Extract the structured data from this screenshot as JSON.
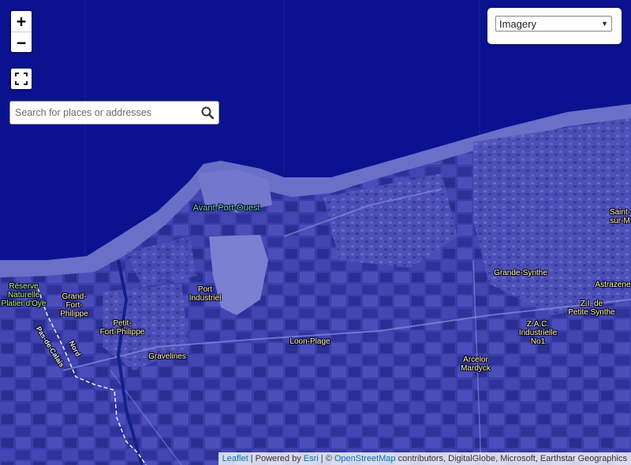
{
  "map": {
    "places": [
      {
        "name": "reserve-naturelle-platier-doye",
        "label": "Réserve\nNaturelle\nPlatier d'Oye",
        "kind": "reserve"
      },
      {
        "name": "grand-fort-philippe",
        "label": "Grand-\nFort-\nPhilippe",
        "kind": "town"
      },
      {
        "name": "petit-fort-philippe",
        "label": "Petit-\nFort-Philippe",
        "kind": "town"
      },
      {
        "name": "gravelines",
        "label": "Gravelines",
        "kind": "town"
      },
      {
        "name": "avant-port-ouest",
        "label": "Avant-Port-Ouest",
        "kind": "water"
      },
      {
        "name": "port-industriel",
        "label": "Port\nIndustriel",
        "kind": "town"
      },
      {
        "name": "loon-plage",
        "label": "Loon-Plage",
        "kind": "town"
      },
      {
        "name": "grande-synthe",
        "label": "Grande-Synthe",
        "kind": "town"
      },
      {
        "name": "arcelor-mardyck",
        "label": "Arcelor\nMardyck",
        "kind": "town"
      },
      {
        "name": "zac-industrielle-no1",
        "label": "Z.A.C.\nIndustrielle\nNo1",
        "kind": "town"
      },
      {
        "name": "zi-de-petite-synthe",
        "label": "Z.I. de\nPetite Synthe",
        "kind": "town"
      },
      {
        "name": "astrazeneca",
        "label": "Astrazene",
        "kind": "town"
      },
      {
        "name": "saint-pol-sur-mer",
        "label": "Saint-\nsur-M",
        "kind": "town"
      }
    ],
    "departments": {
      "pas_de_calais": "Pas-de-Calais",
      "nord": "Nord"
    }
  },
  "controls": {
    "zoom_in": "+",
    "zoom_out": "−",
    "search_placeholder": "Search for places or addresses",
    "basemap_selected": "Imagery"
  },
  "attribution": {
    "leaflet": "Leaflet",
    "powered_by": " | Powered by ",
    "esri": "Esri",
    "sep": " | © ",
    "osm": "OpenStreetMap",
    "rest": " contributors, DigitalGlobe, Microsoft, Earthstar Geographics"
  }
}
